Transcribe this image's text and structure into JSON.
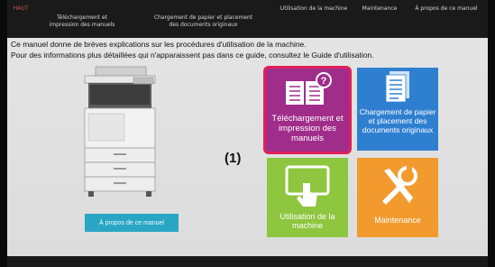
{
  "nav": {
    "haut": "HAUT",
    "telechargement": "Téléchargement et impression des manuels",
    "chargement": "Chargement de papier et placement des documents originaux",
    "utilisation": "Utilisation de la machine",
    "maintenance": "Maintenance",
    "apropos": "À propos de ce manuel"
  },
  "description": {
    "line1": "Ce manuel donne de brèves explications sur les procédures d'utilisation de la machine.",
    "line2": "Pour des informations plus détaillées qui n'apparaissent pas dans ce guide, consultez le Guide d'utilisation."
  },
  "about_button": "À propos de ce manuel",
  "tiles": {
    "telechargement": "Téléchargement et impression des manuels",
    "chargement": "Chargement de papier et placement des documents originaux",
    "utilisation": "Utilisation de la machine",
    "maintenance": "Maintenance"
  },
  "callout": "(1)",
  "colors": {
    "telechargement": "#a02d8a",
    "highlight": "#e0205a",
    "chargement": "#2f7fd1",
    "utilisation": "#8ec63f",
    "maintenance": "#f29a2e",
    "about": "#29a6c4"
  },
  "icons": {
    "telechargement": "manual-question-icon",
    "chargement": "document-stack-icon",
    "utilisation": "touch-screen-icon",
    "maintenance": "tools-icon"
  }
}
